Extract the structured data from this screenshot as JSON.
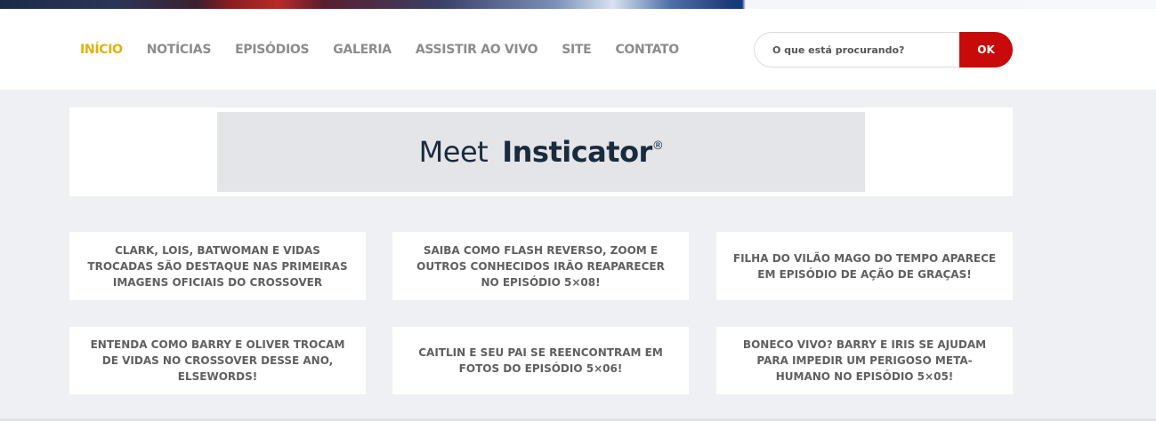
{
  "nav": {
    "items": [
      {
        "label": "INÍCIO",
        "active": true
      },
      {
        "label": "NOTÍCIAS",
        "active": false
      },
      {
        "label": "EPISÓDIOS",
        "active": false
      },
      {
        "label": "GALERIA",
        "active": false
      },
      {
        "label": "ASSISTIR AO VIVO",
        "active": false
      },
      {
        "label": "SITE",
        "active": false
      },
      {
        "label": "CONTATO",
        "active": false
      }
    ]
  },
  "search": {
    "placeholder": "O que está procurando?",
    "button_label": "OK"
  },
  "ad": {
    "meet": "Meet",
    "brand": "Insticator",
    "registered": "®"
  },
  "posts": [
    {
      "title": "CLARK, LOIS, BATWOMAN E VIDAS TROCADAS SÃO DESTAQUE NAS PRIMEIRAS IMAGENS OFICIAIS DO CROSSOVER"
    },
    {
      "title": "SAIBA COMO FLASH REVERSO, ZOOM E OUTROS CONHECIDOS IRÃO REAPARECER NO EPISÓDIO 5×08!"
    },
    {
      "title": "FILHA DO VILÃO MAGO DO TEMPO APARECE EM EPISÓDIO DE AÇÃO DE GRAÇAS!"
    },
    {
      "title": "ENTENDA COMO BARRY E OLIVER TROCAM DE VIDAS NO CROSSOVER DESSE ANO, ELSEWORDS!"
    },
    {
      "title": "CAITLIN E SEU PAI SE REENCONTRAM EM FOTOS DO EPISÓDIO 5×06!"
    },
    {
      "title": "BONECO VIVO? BARRY E IRIS SE AJUDAM PARA IMPEDIR UM PERIGOSO META-HUMANO NO EPISÓDIO 5×05!"
    }
  ],
  "colors": {
    "active_nav": "#e1b20b",
    "nav_text": "#8c8c8c",
    "search_button": "#c80a0a",
    "page_background": "#eef0f3"
  }
}
